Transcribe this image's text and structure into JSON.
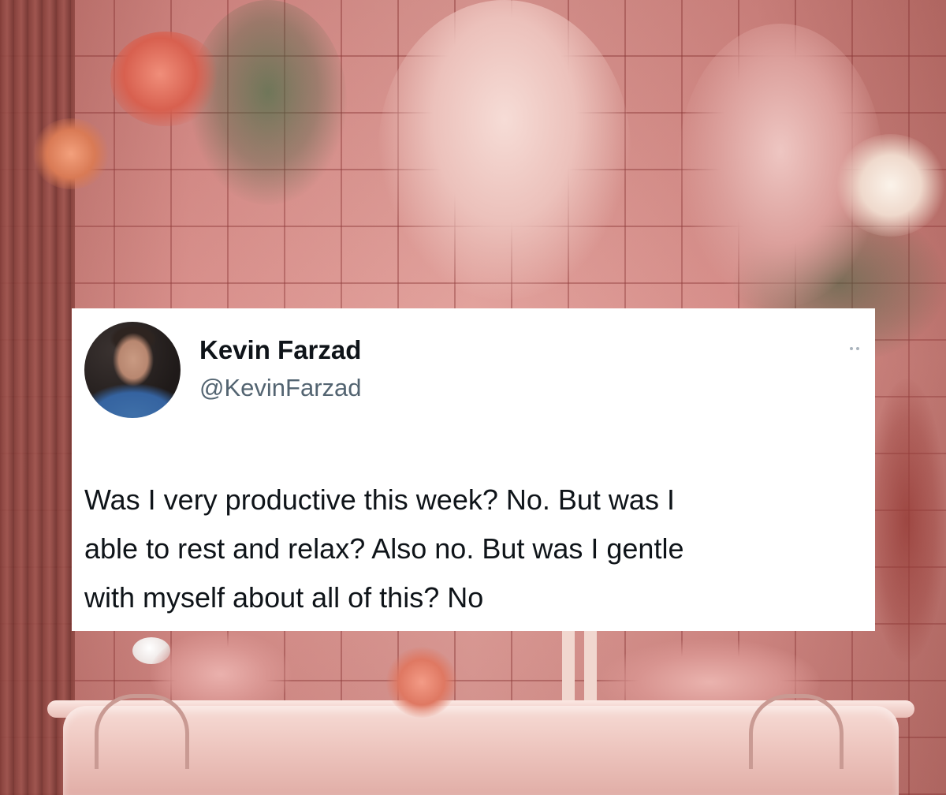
{
  "tweet": {
    "display_name": "Kevin Farzad",
    "handle": "@KevinFarzad",
    "text_lines": [
      "Was I very productive this week? No. But was I",
      "able to rest and relax? Also no. But was I gentle",
      "with myself about all of this? No"
    ]
  },
  "icons": {
    "more": "more-options-icon",
    "avatar": "profile-avatar"
  },
  "colors": {
    "card_background": "#ffffff",
    "name_color": "#0f1419",
    "handle_color": "#536471",
    "scene_tile_pink": "#e3a39e"
  }
}
